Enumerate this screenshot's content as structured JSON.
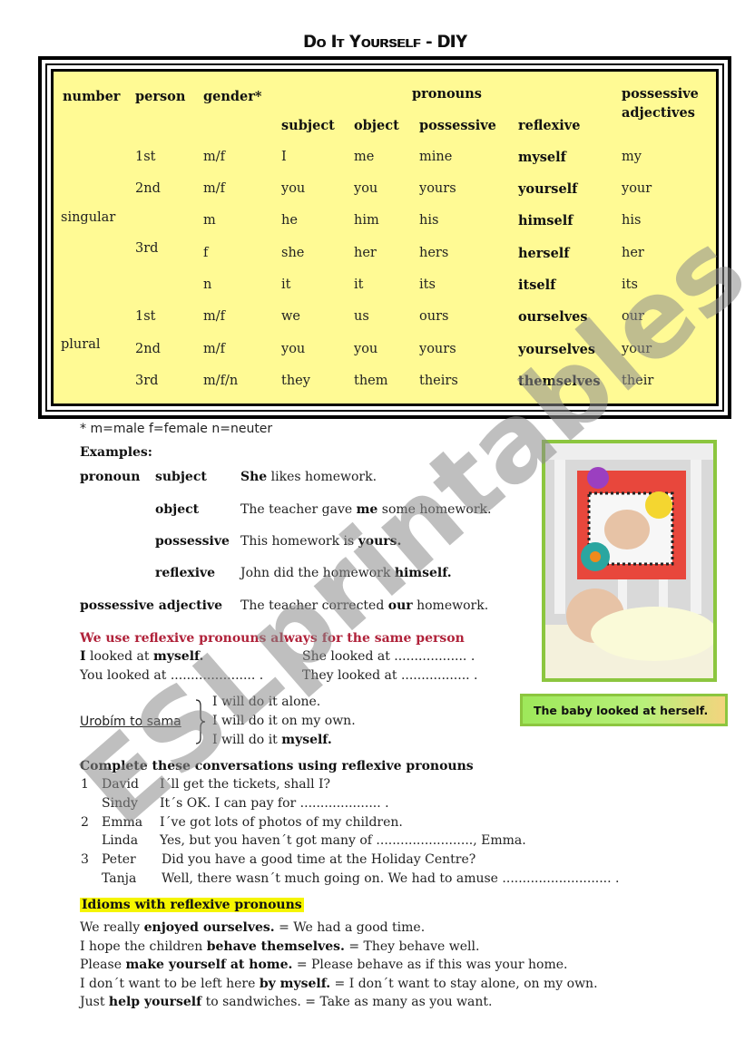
{
  "title": "Do It Yourself -  DIY",
  "table": {
    "headers": {
      "number": "number",
      "person": "person",
      "gender": "gender*",
      "pronouns": "pronouns",
      "subject": "subject",
      "object": "object",
      "possessive": "possessive",
      "reflexive": "reflexive",
      "poss_adj_line1": "possessive",
      "poss_adj_line2": "adjectives"
    },
    "number_labels": {
      "singular": "singular",
      "plural": "plural"
    },
    "rows": [
      {
        "person": "1st",
        "gender": "m/f",
        "subject": "I",
        "object": "me",
        "possessive": "mine",
        "reflexive": "myself",
        "poss_adj": "my"
      },
      {
        "person": "2nd",
        "gender": "m/f",
        "subject": "you",
        "object": "you",
        "possessive": "yours",
        "reflexive": "yourself",
        "poss_adj": "your"
      },
      {
        "person": "",
        "gender": "m",
        "subject": "he",
        "object": "him",
        "possessive": "his",
        "reflexive": "himself",
        "poss_adj": "his"
      },
      {
        "person": "3rd",
        "gender": "f",
        "subject": "she",
        "object": "her",
        "possessive": "hers",
        "reflexive": "herself",
        "poss_adj": "her"
      },
      {
        "person": "",
        "gender": "n",
        "subject": "it",
        "object": "it",
        "possessive": "its",
        "reflexive": "itself",
        "poss_adj": "its"
      },
      {
        "person": "1st",
        "gender": "m/f",
        "subject": "we",
        "object": "us",
        "possessive": "ours",
        "reflexive": "ourselves",
        "poss_adj": "our"
      },
      {
        "person": "2nd",
        "gender": "m/f",
        "subject": "you",
        "object": "you",
        "possessive": "yours",
        "reflexive": "yourselves",
        "poss_adj": "your"
      },
      {
        "person": "3rd",
        "gender": "m/f/n",
        "subject": "they",
        "object": "them",
        "possessive": "theirs",
        "reflexive": "themselves",
        "poss_adj": "their"
      }
    ]
  },
  "footnote": "* m=male f=female n=neuter",
  "examples": {
    "heading": "Examples:",
    "pronoun_label": "pronoun",
    "items": [
      {
        "label": "subject",
        "pre": "",
        "bold": "She",
        "post": " likes homework."
      },
      {
        "label": "object",
        "pre": "The teacher gave ",
        "bold": "me",
        "post": " some homework."
      },
      {
        "label": "possessive",
        "pre": "This homework is ",
        "bold": "yours.",
        "post": ""
      },
      {
        "label": "reflexive",
        "pre": "John did the homework ",
        "bold": "himself.",
        "post": ""
      }
    ],
    "poss_adj": {
      "label": "possessive adjective",
      "pre": "The teacher corrected ",
      "bold": "our",
      "post": " homework."
    }
  },
  "rule": {
    "heading": "We use reflexive pronouns always for the same person",
    "left": [
      {
        "bold_pre": "I",
        "mid": " looked at ",
        "bold": "myself.",
        "post": ""
      },
      {
        "bold_pre": "",
        "mid": "You looked at ",
        "bold": "",
        "post": "..................... ."
      }
    ],
    "right": [
      {
        "text": "She looked at ",
        "dots": ".................. ."
      },
      {
        "text": "They looked at ",
        "dots": "................. ."
      }
    ]
  },
  "alone": {
    "label": "Urobím to sama",
    "lines": [
      "I will do it alone.",
      "I will do it on my own.",
      "I will do it "
    ],
    "bold_last": "myself."
  },
  "exercise": {
    "heading": "Complete these conversations using reflexive pronouns",
    "items": [
      {
        "num": "1",
        "name": "David",
        "text": "I´ll get the tickets, shall I?"
      },
      {
        "num": "",
        "name": "Sindy",
        "text": "It´s OK. I can pay for ....................    ."
      },
      {
        "num": "2",
        "name": "Emma",
        "text": "I´ve got lots of photos of my children."
      },
      {
        "num": "",
        "name": "Linda",
        "text": "Yes, but you haven´t got many of  ........................, Emma."
      },
      {
        "num": "3",
        "name": "Peter",
        "text": "Did you have a good time at the Holiday Centre?"
      },
      {
        "num": "",
        "name": "Tanja",
        "text": "Well, there wasn´t much going on. We had to amuse ...........................  ."
      }
    ]
  },
  "idioms": {
    "heading": "Idioms with reflexive pronouns",
    "items": [
      {
        "pre": "We really ",
        "bold": "enjoyed ourselves.",
        "post": "  =   We had a good time."
      },
      {
        "pre": "I hope the children ",
        "bold": "behave themselves.",
        "post": " =  They behave well."
      },
      {
        "pre": "Please ",
        "bold": "make yourself at home.",
        "post": " =  Please behave as if this was your home."
      },
      {
        "pre": "I don´t want to be left here ",
        "bold": "by myself.",
        "post": "  =  I don´t want to stay alone, on my own."
      },
      {
        "pre": "Just ",
        "bold": "help yourself",
        "post": " to sandwiches.  =  Take as many as you want."
      }
    ]
  },
  "photo": {
    "alt": "baby looking at herself in a crib mirror"
  },
  "caption": "The baby looked at herself.",
  "watermark": "ESLprintables.com",
  "colors": {
    "table_bg": "#fffa94",
    "accent_green": "#8cc63f",
    "rule_red": "#b0223a",
    "highlight": "#f5f500"
  }
}
